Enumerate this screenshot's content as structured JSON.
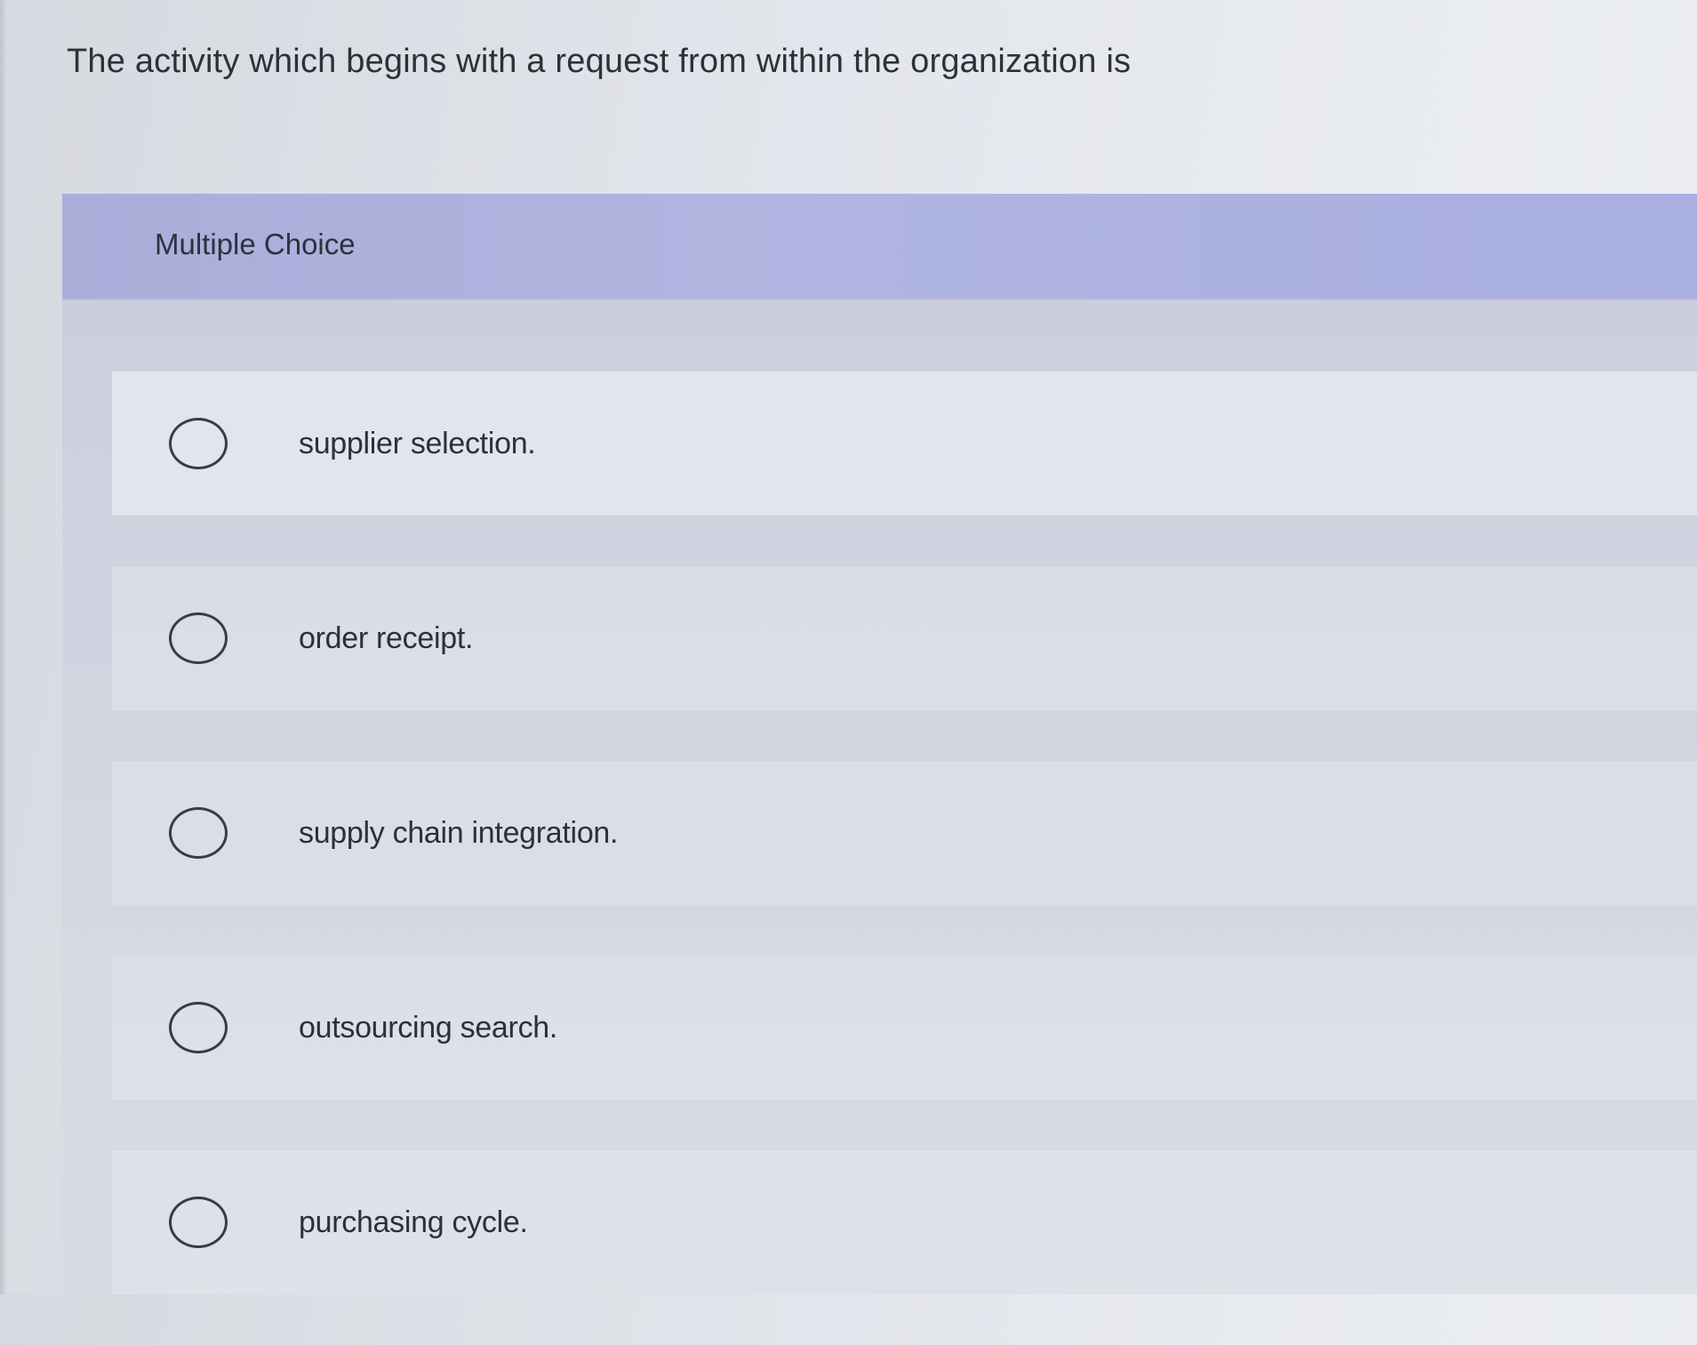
{
  "question": {
    "text": "The activity which begins with a request from within the organization is"
  },
  "panel": {
    "title": "Multiple Choice"
  },
  "options": [
    {
      "label": "supplier selection.",
      "selected": false
    },
    {
      "label": "order receipt.",
      "selected": false
    },
    {
      "label": "supply chain integration.",
      "selected": false
    },
    {
      "label": "outsourcing search.",
      "selected": false
    },
    {
      "label": "purchasing cycle.",
      "selected": false
    }
  ],
  "colors": {
    "header": "#aeb3df",
    "panel": "#cfd2df",
    "page": "#e3e6ec",
    "text": "#2f3138"
  }
}
